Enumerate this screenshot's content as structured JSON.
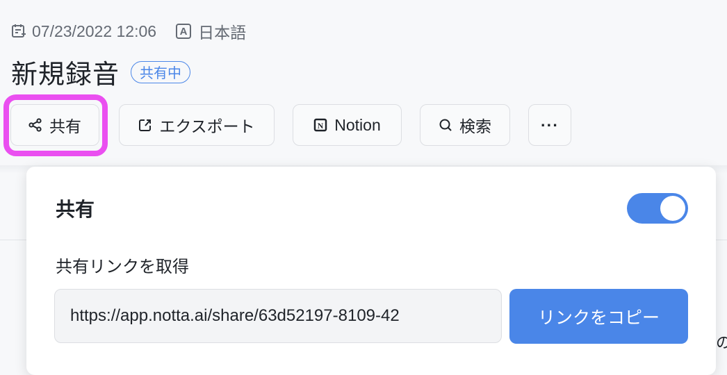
{
  "meta": {
    "calendar_icon": "calendar-icon",
    "date": "07/23/2022 12:06",
    "language_icon_letter": "A",
    "language": "日本語"
  },
  "title": "新規録音",
  "badge": "共有中",
  "toolbar": {
    "share_label": "共有",
    "export_label": "エクスポート",
    "notion_label": "Notion",
    "notion_icon_letter": "N",
    "search_label": "検索",
    "more_label": "···"
  },
  "share_panel": {
    "title": "共有",
    "toggle_on": true,
    "link_label": "共有リンクを取得",
    "link_value": "https://app.notta.ai/share/63d52197-8109-42",
    "copy_button_label": "リンクをコピー"
  },
  "background_fragment": "の",
  "colors": {
    "accent": "#4a86e8",
    "highlight": "#ea4ff0"
  }
}
